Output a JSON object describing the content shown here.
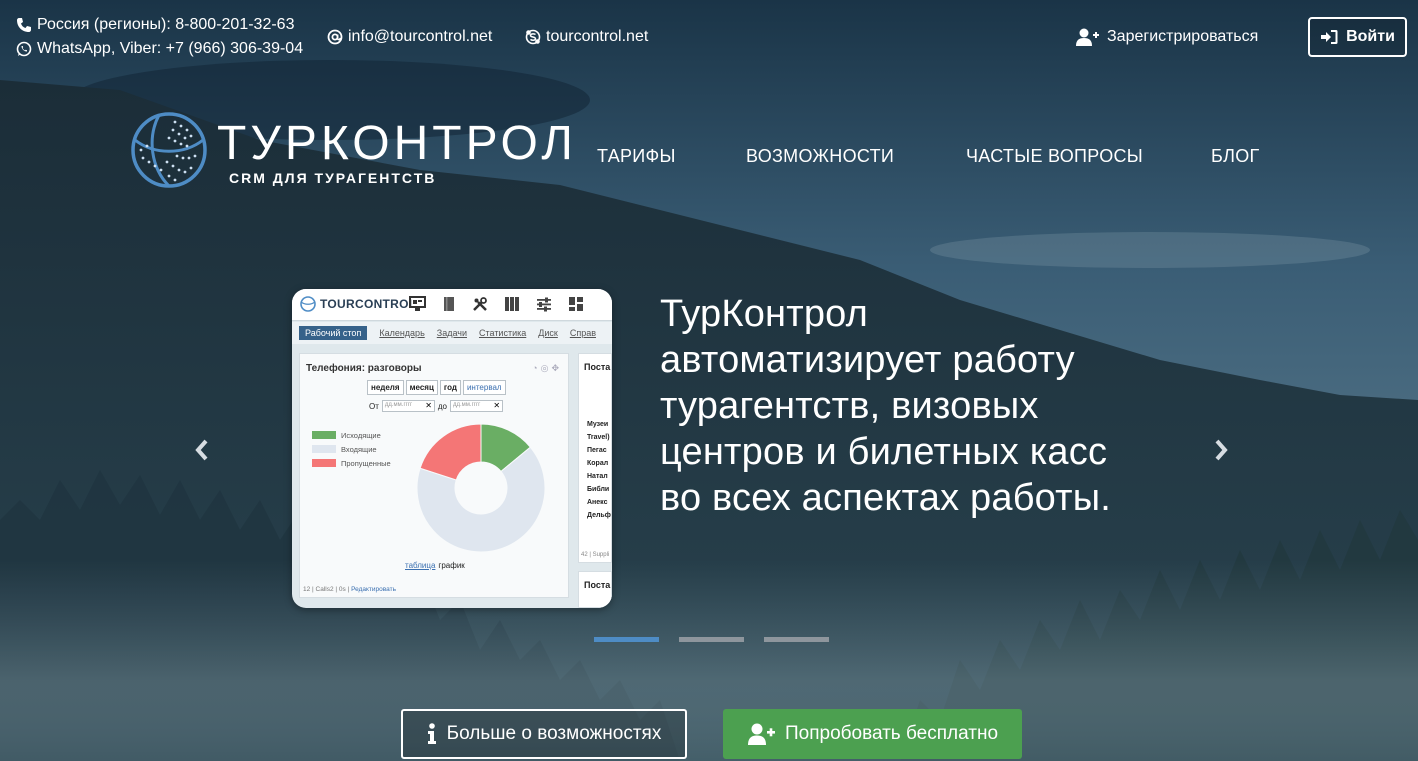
{
  "topbar": {
    "phone": "Россия (регионы): 8-800-201-32-63",
    "whatsapp": "WhatsApp, Viber: +7 (966) 306-39-04",
    "email": "info@tourcontrol.net",
    "skype": "tourcontrol.net",
    "register_label": "Зарегистрироваться",
    "login_label": "Войти"
  },
  "logo": {
    "name": "ТУРКОНТРОЛ",
    "tagline": "CRM ДЛЯ ТУРАГЕНТСТВ"
  },
  "nav": {
    "items": [
      {
        "label": "ТАРИФЫ"
      },
      {
        "label": "ВОЗМОЖНОСТИ"
      },
      {
        "label": "ЧАСТЫЕ ВОПРОСЫ"
      },
      {
        "label": "БЛОГ"
      }
    ]
  },
  "slider": {
    "headline": "ТурКонтрол автоматизирует работу турагентств, визовых центров и билетных касс во всех аспектах работы.",
    "slide_count": 3,
    "active_index": 0
  },
  "mock_app": {
    "brand": "TOURCONTROL",
    "tabs": [
      "Рабочий стоп",
      "Календарь",
      "Задачи",
      "Статистика",
      "Диск",
      "Справ"
    ],
    "panel": {
      "title": "Телефония: разговоры",
      "periods": [
        "неделя",
        "месяц",
        "год",
        "интервал"
      ],
      "date_from_label": "От",
      "date_to_label": "до",
      "date_placeholder": "дд.мм.гггг",
      "clear_mark": "✕",
      "link_table": "таблица",
      "link_chart": "график",
      "footer_text": "12 | Calls2 | 0s |",
      "footer_edit": "Редактировать"
    },
    "chart_data": {
      "type": "pie",
      "legend": [
        "Исходящие",
        "Входящие",
        "Пропущенные"
      ],
      "values": [
        14,
        66,
        20
      ],
      "colors": [
        "#6aae64",
        "#dfe6ef",
        "#f47676"
      ]
    },
    "side": {
      "title": "Поста",
      "items": [
        "Музеи",
        "Travel)",
        "Пегас",
        "Корал",
        "Натал",
        "Библи",
        "Анекс",
        "Дельф"
      ],
      "footer": "42 | Suppli",
      "second_title": "Поста"
    }
  },
  "buttons": {
    "more_label": "Больше о возможностях",
    "try_label": "Попробовать бесплатно"
  },
  "colors": {
    "accent": "#4e8cc5",
    "success": "#4ca050"
  }
}
